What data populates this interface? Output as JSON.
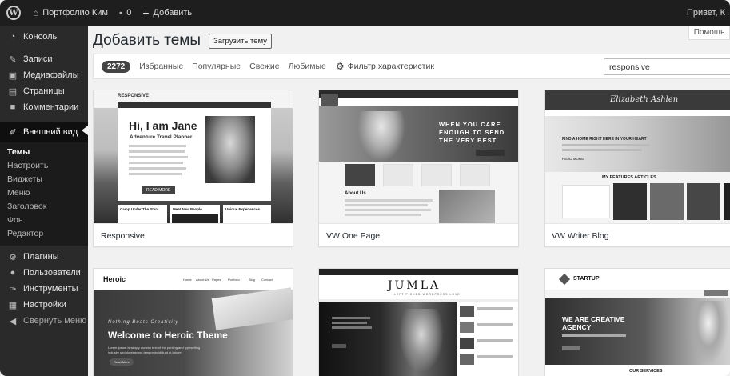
{
  "adminbar": {
    "site_name": "Портфолио Ким",
    "comments_count": "0",
    "add_new": "Добавить",
    "greeting": "Привет, К"
  },
  "sidebar": {
    "items": [
      {
        "label": "Консоль",
        "icon": "dashboard-icon"
      },
      {
        "label": "Записи",
        "icon": "pin-icon"
      },
      {
        "label": "Медиафайлы",
        "icon": "media-icon"
      },
      {
        "label": "Страницы",
        "icon": "page-icon"
      },
      {
        "label": "Комментарии",
        "icon": "comment-icon"
      },
      {
        "label": "Внешний вид",
        "icon": "brush-icon"
      },
      {
        "label": "Плагины",
        "icon": "plugin-icon"
      },
      {
        "label": "Пользователи",
        "icon": "users-icon"
      },
      {
        "label": "Инструменты",
        "icon": "wrench-icon"
      },
      {
        "label": "Настройки",
        "icon": "settings-icon"
      },
      {
        "label": "Свернуть меню",
        "icon": "collapse-icon"
      }
    ],
    "submenu": [
      "Темы",
      "Настроить",
      "Виджеты",
      "Меню",
      "Заголовок",
      "Фон",
      "Редактор"
    ]
  },
  "main": {
    "help_tab": "Помощь",
    "title": "Добавить темы",
    "upload_button": "Загрузить тему",
    "filters": {
      "count": "2272",
      "links": [
        "Избранные",
        "Популярные",
        "Свежие",
        "Любимые"
      ],
      "feature_filter": "Фильтр характеристик",
      "search_value": "responsive"
    },
    "themes": [
      {
        "name": "Responsive"
      },
      {
        "name": "VW One Page"
      },
      {
        "name": "VW Writer Blog"
      },
      {
        "name": ""
      },
      {
        "name": ""
      },
      {
        "name": ""
      }
    ],
    "previews": {
      "responsive": {
        "brand": "RESPONSIVE",
        "headline": "Hi, I am Jane",
        "sub": "Adventure Travel Planner",
        "button": "READ MORE",
        "cards": [
          "Camp Under The Stars",
          "Meet New People",
          "Unique Experiences"
        ]
      },
      "vw_one_page": {
        "hero": [
          "WHEN YOU CARE",
          "ENOUGH TO SEND",
          "THE VERY BEST"
        ],
        "about": "About Us"
      },
      "vw_writer": {
        "logo": "Elizabeth Ashlen",
        "hero": "FIND A HOME RIGHT HERE IN YOUR HEART",
        "read_more": "READ MORE",
        "section": "MY FEATURES ARTICLES"
      },
      "heroic": {
        "logo": "Heroic",
        "nav": [
          "Home",
          "About Us",
          "Pages",
          "Portfolio",
          "Blog",
          "Contact"
        ],
        "kicker": "Nothing Beats Creativity",
        "headline": "Welcome to Heroic Theme",
        "body": "Lorem Ipsum is simply dummy text of the printing and typesetting industry sed do eiusmod tempor incididunt ut labore",
        "button": "Read More"
      },
      "jumla": {
        "logo": "JUMLA",
        "tagline": "LEFT PICKED WORDPRESS LOVE"
      },
      "startup": {
        "logo": "STARTUP",
        "headline": [
          "WE ARE CREATIVE",
          "AGENCY"
        ],
        "services": "OUR SERVICES"
      }
    }
  },
  "colors": {
    "adminbar_bg": "#1e1e1e",
    "sidebar_bg": "#2a2a2a",
    "page_bg": "#f1f1f1",
    "badge_bg": "#444444"
  }
}
